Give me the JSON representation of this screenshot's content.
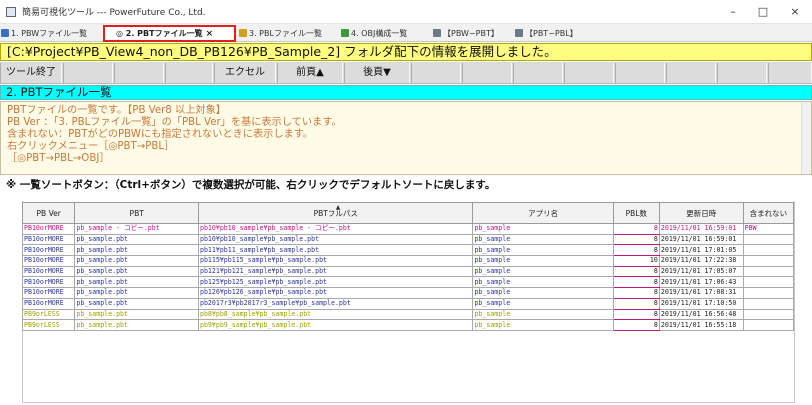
{
  "window": {
    "title": "簡易可視化ツール --- PowerFuture Co., Ltd.",
    "minimize": "–",
    "maximize": "□",
    "close": "×"
  },
  "tabs": [
    {
      "label": "1. PBWファイル一覧",
      "icon": "grid-icon",
      "active": false
    },
    {
      "label": "◎ 2. PBTファイル一覧",
      "icon": "target-icon",
      "active": true
    },
    {
      "label": "3. PBLファイル一覧",
      "icon": "library-icon",
      "active": false
    },
    {
      "label": "4. OBJ構成一覧",
      "icon": "tree-icon",
      "active": false
    },
    {
      "label": "【PBW−PBT】",
      "icon": "link-icon",
      "active": false
    },
    {
      "label": "【PBT−PBL】",
      "icon": "link-icon",
      "active": false
    }
  ],
  "tab_close": "×",
  "message": "[C:¥Project¥PB_View4_non_DB_PB126¥PB_Sample_2] フォルダ配下の情報を展開しました。",
  "toolbar": {
    "exit": "ツール終了",
    "excel": "エクセル",
    "prev": "前頁▲",
    "next": "後頁▼"
  },
  "section_title": "2. PBTファイル一覧",
  "description": [
    "PBTファイルの一覧です。【PB Ver8 以上対象】",
    "PB Ver    ：「3. PBLファイル一覧」の「PBL Ver」を基に表示しています。",
    "含まれない：PBTがどのPBWにも指定されないときに表示します。",
    "右クリックメニュー［◎PBT→PBL］",
    "                   ［◎PBT→PBL→OBJ］"
  ],
  "sort_note": "※  一覧ソートボタン：（Ctrl+ボタン）で複数選択が可能、右クリックでデフォルトソートに戻します。",
  "columns": [
    "PB Ver",
    "PBT",
    "PBTフルパス",
    "アプリ名",
    "PBL数",
    "更新日時",
    "含まれない"
  ],
  "rows": [
    {
      "ver": "PB10orMORE",
      "pbt": "pb_sample - コピー.pbt",
      "path": "pb10¥pb10_sample¥pb_sample - コピー.pbt",
      "app": "pb_sample",
      "pbl": "8",
      "date": "2019/11/01 16:59:01",
      "excl": "PBW",
      "selected": true
    },
    {
      "ver": "PB10orMORE",
      "pbt": "pb_sample.pbt",
      "path": "pb10¥pb10_sample¥pb_sample.pbt",
      "app": "pb_sample",
      "pbl": "8",
      "date": "2019/11/01 16:59:01",
      "excl": "",
      "selected": false
    },
    {
      "ver": "PB10orMORE",
      "pbt": "pb_sample.pbt",
      "path": "pb11¥pb11_sample¥pb_sample.pbt",
      "app": "pb_sample",
      "pbl": "8",
      "date": "2019/11/01 17:01:05",
      "excl": "",
      "selected": false
    },
    {
      "ver": "PB10orMORE",
      "pbt": "pb_sample.pbt",
      "path": "pb115¥pb115_sample¥pb_sample.pbt",
      "app": "pb_sample",
      "pbl": "10",
      "date": "2019/11/01 17:22:38",
      "excl": "",
      "selected": false
    },
    {
      "ver": "PB10orMORE",
      "pbt": "pb_sample.pbt",
      "path": "pb121¥pb121_sample¥pb_sample.pbt",
      "app": "pb_sample",
      "pbl": "8",
      "date": "2019/11/01 17:05:07",
      "excl": "",
      "selected": false
    },
    {
      "ver": "PB10orMORE",
      "pbt": "pb_sample.pbt",
      "path": "pb125¥pb125_sample¥pb_sample.pbt",
      "app": "pb_sample",
      "pbl": "8",
      "date": "2019/11/01 17:06:43",
      "excl": "",
      "selected": false
    },
    {
      "ver": "PB10orMORE",
      "pbt": "pb_sample.pbt",
      "path": "pb126¥pb126_sample¥pb_sample.pbt",
      "app": "pb_sample",
      "pbl": "8",
      "date": "2019/11/01 17:08:31",
      "excl": "",
      "selected": false
    },
    {
      "ver": "PB10orMORE",
      "pbt": "pb_sample.pbt",
      "path": "pb2017r3¥pb2017r3_sample¥pb_sample.pbt",
      "app": "pb_sample",
      "pbl": "8",
      "date": "2019/11/01 17:10:50",
      "excl": "",
      "selected": false
    },
    {
      "ver": "PB9orLESS",
      "pbt": "pb_sample.pbt",
      "path": "pb8¥pb8_sample¥pb_sample.pbt",
      "app": "pb_sample",
      "pbl": "8",
      "date": "2019/11/01 16:56:48",
      "excl": "",
      "selected": false
    },
    {
      "ver": "PB9orLESS",
      "pbt": "pb_sample.pbt",
      "path": "pb9¥pb9_sample¥pb_sample.pbt",
      "app": "pb_sample",
      "pbl": "8",
      "date": "2019/11/01 16:55:18",
      "excl": "",
      "selected": false
    }
  ],
  "colors": {
    "message_bg": "#fffd7f",
    "section_bg": "#00ffff",
    "description_text": "#c87a3a",
    "active_tab_border": "#e0201f",
    "selected_row_text": "#c0168a"
  }
}
